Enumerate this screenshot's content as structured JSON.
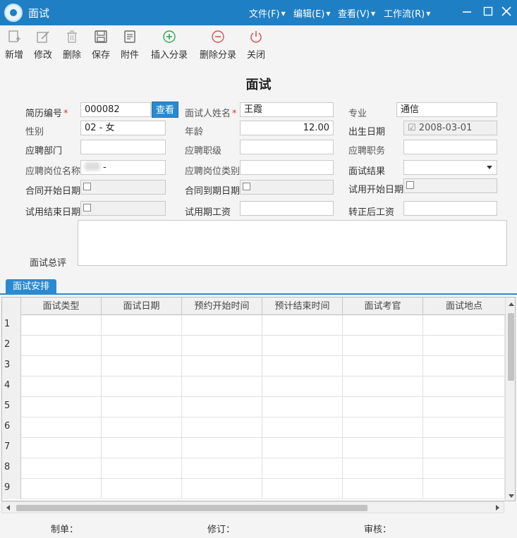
{
  "window": {
    "title": "面试"
  },
  "menu": [
    {
      "label": "文件(F)"
    },
    {
      "label": "编辑(E)"
    },
    {
      "label": "查看(V)"
    },
    {
      "label": "工作流(R)"
    }
  ],
  "toolbar": {
    "new": "新增",
    "edit": "修改",
    "delete": "删除",
    "save": "保存",
    "attach": "附件",
    "insert_entry": "插入分录",
    "delete_entry": "删除分录",
    "close": "关闭"
  },
  "colors": {
    "titlebar": "#1f7fc4",
    "accent": "#2a8ad0",
    "required": "#d33333",
    "insert_icon": "#2eaa4a",
    "delete_icon": "#e05050"
  },
  "form": {
    "title": "面试",
    "resume_no_label": "简历编号",
    "resume_no_value": "000082",
    "view_button": "查看",
    "interviewee_label": "面试人姓名",
    "interviewee_value": "王霞",
    "major_label": "专业",
    "major_value": "通信",
    "gender_label": "性别",
    "gender_value": "02 - 女",
    "age_label": "年龄",
    "age_value": "12.00",
    "birth_label": "出生日期",
    "birth_value": "2008-03-01",
    "dept_label": "应聘部门",
    "dept_value": "",
    "rank_label": "应聘职级",
    "rank_value": "",
    "duty_label": "应聘职务",
    "duty_value": "",
    "position_label": "应聘岗位名称",
    "position_value": "-",
    "position_type_label": "应聘岗位类别",
    "position_type_value": "",
    "result_label": "面试结果",
    "result_value": "",
    "contract_start_label": "合同开始日期",
    "contract_end_label": "合同到期日期",
    "probation_start_label": "试用开始日期",
    "probation_end_label": "试用结束日期",
    "probation_salary_label": "试用期工资",
    "probation_salary_value": "",
    "regular_salary_label": "转正后工资",
    "regular_salary_value": "",
    "summary_label": "面试总评",
    "summary_value": ""
  },
  "tab": {
    "label": "面试安排"
  },
  "grid": {
    "columns": [
      "面试类型",
      "面试日期",
      "预约开始时间",
      "预计结束时间",
      "面试考官",
      "面试地点"
    ],
    "rows": [
      "1",
      "2",
      "3",
      "4",
      "5",
      "6",
      "7",
      "8",
      "9"
    ]
  },
  "footer": {
    "maker": "制单：",
    "revise": "修订：",
    "audit": "审核："
  }
}
